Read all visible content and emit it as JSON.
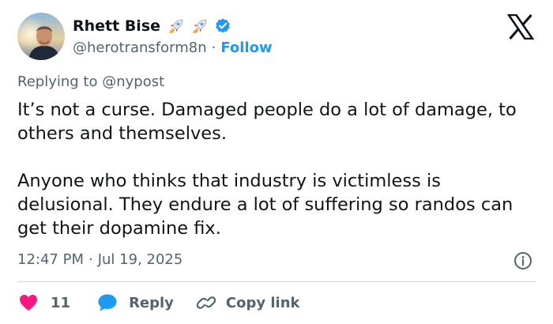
{
  "user": {
    "display_name": "Rhett Bise",
    "handle": "@herotransform8n",
    "follow_label": "Follow",
    "separator": "·",
    "name_emoji": [
      "rocket-icon",
      "rocket-icon"
    ],
    "verified": true
  },
  "tweet": {
    "replying_prefix": "Replying to",
    "replying_to": "@nypost",
    "paragraphs": [
      "It’s not a curse. Damaged people do a lot of damage, to others and themselves.",
      "Anyone who thinks that industry is victimless is delusional. They endure a lot of suffering so randos can get their dopamine fix."
    ],
    "time": "12:47 PM",
    "date": "Jul 19, 2025",
    "separator": "·"
  },
  "actions": {
    "like_count": "11",
    "reply_label": "Reply",
    "copy_link_label": "Copy link"
  },
  "colors": {
    "accent": "#1d9bf0",
    "like": "#f91880",
    "secondary_text": "#536471",
    "primary_text": "#0f1419",
    "divider": "#cfd9de"
  },
  "icons": {
    "brand": "x-logo-icon",
    "info": "info-icon",
    "like": "heart-icon",
    "reply": "speech-bubble-icon",
    "copy": "link-icon"
  }
}
